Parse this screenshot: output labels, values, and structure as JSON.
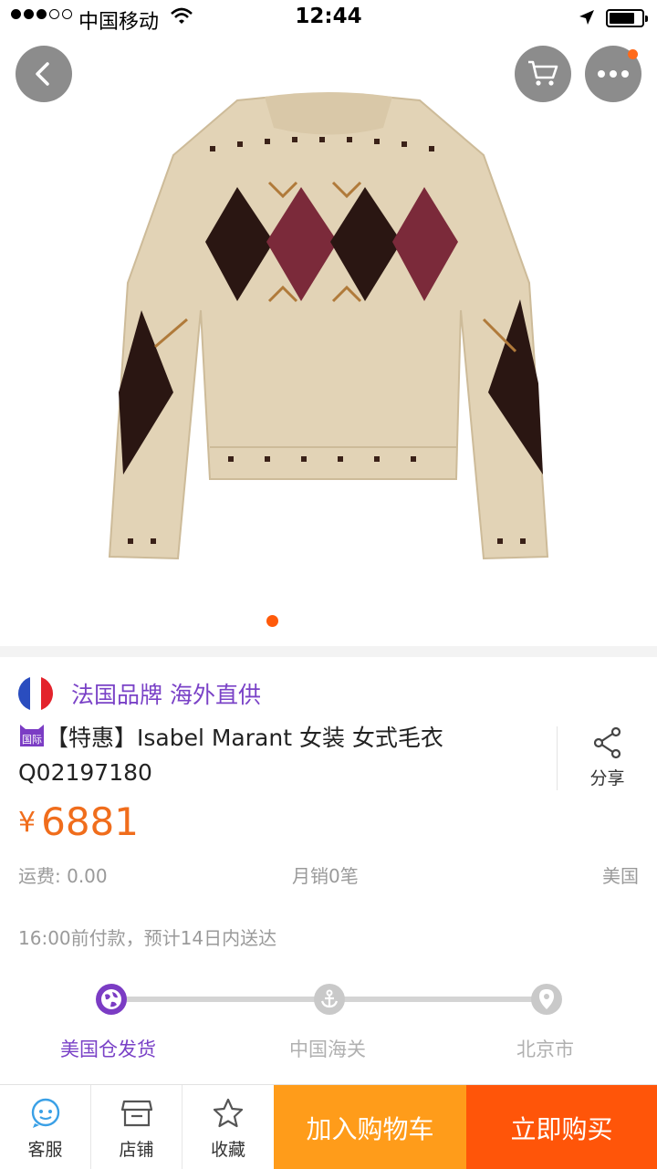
{
  "status_bar": {
    "carrier": "中国移动",
    "time": "12:44",
    "signal_bars_filled": 3,
    "signal_bars_total": 5,
    "battery_level": 0.8
  },
  "gallery": {
    "image": "beige argyle knit sweater",
    "page_count": 1,
    "current_page": 1,
    "accent_color": "#ff5a0a"
  },
  "nav": {
    "back_icon": "chevron-left-icon",
    "cart_icon": "cart-icon",
    "more_icon": "more-dots-icon"
  },
  "brand": {
    "flag": "france-flag",
    "text": "法国品牌 海外直供"
  },
  "product": {
    "badge": "国际",
    "title_line1": "【特惠】Isabel Marant 女装 女式毛衣",
    "title_line2": "Q02197180",
    "currency": "¥",
    "price": "6881",
    "price_color": "#f06d1c"
  },
  "share": {
    "label": "分享"
  },
  "meta": {
    "shipping_fee": "运费: 0.00",
    "monthly_sales": "月销0笔",
    "origin": "美国"
  },
  "delivery": {
    "note": "16:00前付款，预计14日内送达",
    "steps": [
      {
        "label": "美国仓发货",
        "icon": "globe-icon",
        "active": true
      },
      {
        "label": "中国海关",
        "icon": "anchor-icon",
        "active": false
      },
      {
        "label": "北京市",
        "icon": "location-pin-icon",
        "active": false
      }
    ],
    "active_color": "#7b3cc4"
  },
  "bottom_bar": {
    "service_label": "客服",
    "store_label": "店铺",
    "favorite_label": "收藏",
    "add_to_cart_label": "加入购物车",
    "buy_now_label": "立即购买",
    "add_to_cart_color": "#ff9c1a",
    "buy_now_color": "#ff5509"
  }
}
